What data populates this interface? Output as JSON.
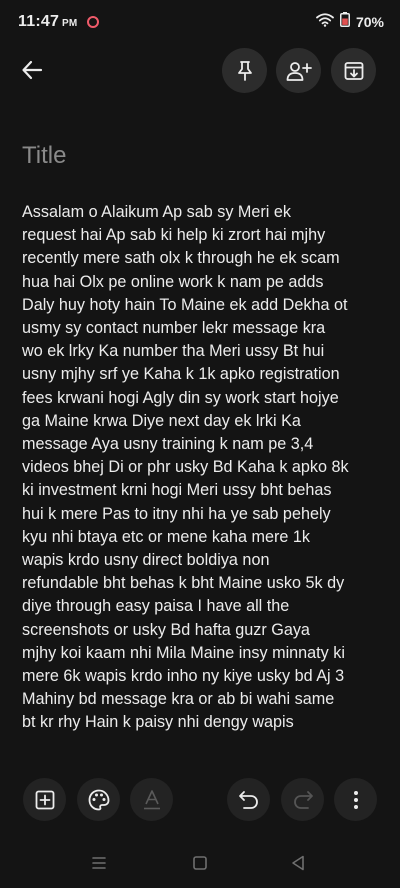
{
  "status_bar": {
    "time": "11:47",
    "time_suffix": "PM",
    "battery_percent": "70%",
    "icons": [
      "recording-indicator-icon",
      "wifi-icon",
      "battery-icon"
    ]
  },
  "toolbar": {
    "icons": [
      "back-arrow-icon",
      "pin-icon",
      "add-collaborator-icon",
      "archive-icon"
    ]
  },
  "note": {
    "title_placeholder": "Title",
    "body": "Assalam o Alaikum Ap sab sy Meri ek\nrequest hai Ap sab ki help ki zrort hai mjhy\nrecently mere sath olx k through he ek scam\nhua hai Olx pe online work k nam pe adds\nDaly huy hoty hain To Maine ek add Dekha ot\nusmy sy contact number lekr message kra\nwo ek lrky Ka number tha Meri ussy Bt hui\nusny mjhy srf ye Kaha k 1k apko registration\nfees krwani hogi Agly din sy work start hojye\nga Maine krwa Diye next day ek lrki Ka\nmessage Aya usny training k nam pe 3,4\nvideos bhej Di or phr usky Bd Kaha k apko 8k\nki investment krni hogi Meri ussy bht behas\nhui k mere Pas to itny nhi ha ye sab pehely\nkyu nhi btaya etc or mene kaha mere 1k\nwapis krdo usny direct boldiya non\nrefundable bht behas k bht Maine usko 5k dy\ndiye through easy paisa I have all the\nscreenshots or usky Bd hafta guzr Gaya\nmjhy koi kaam nhi Mila Maine insy minnaty ki\nmere 6k wapis krdo inho ny kiye usky bd Aj 3\nMahiny bd message kra or ab bi wahi same\nbt kr rhy Hain k paisy nhi dengy wapis"
  },
  "bottom_toolbar": {
    "icons": [
      "add-box-icon",
      "palette-icon",
      "text-format-icon",
      "undo-icon",
      "redo-icon",
      "more-vert-icon"
    ]
  },
  "system_nav": {
    "icons": [
      "recents-icon",
      "home-icon",
      "nav-back-icon"
    ]
  },
  "colors": {
    "background": "#141414",
    "button_background": "#2c2c2c",
    "text": "#ececec",
    "placeholder": "#8a8a8a",
    "recording_dot": "#ef5b6a",
    "battery_fill": "#e05050"
  }
}
